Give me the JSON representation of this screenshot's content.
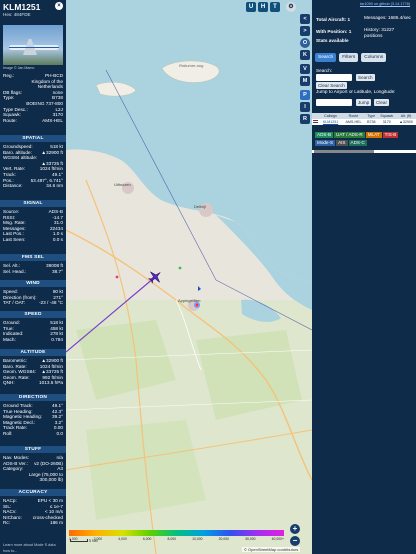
{
  "left": {
    "callsign": "KLM1251",
    "subtitle": "Hex: 484FDE",
    "photo_credit": "Image © Jan Mamo",
    "reg": [
      {
        "k": "Reg.:",
        "v": "PH-BCD"
      },
      {
        "k": "",
        "v": "Kingdom of the"
      },
      {
        "k": "",
        "v": "Netherlands"
      },
      {
        "k": "DB flags:",
        "v": "none"
      },
      {
        "k": "Type:",
        "v": "B738"
      },
      {
        "k": "",
        "v": "BOEING 737-800"
      },
      {
        "k": "Type Desc.:",
        "v": "L2J"
      },
      {
        "k": "Squawk:",
        "v": "3170"
      },
      {
        "k": "Route:",
        "v": "AMS-HEL"
      }
    ],
    "sections": {
      "spatial": "SPATIAL",
      "signal": "SIGNAL",
      "fms": "FMS SEL",
      "wind": "WIND",
      "speed": "SPEED",
      "altitude": "ALTITUDE",
      "direction": "DIRECTION",
      "stuff": "STUFF",
      "accuracy": "ACCURACY"
    },
    "spatial": [
      {
        "k": "Groundspeed:",
        "v": "518 kt"
      },
      {
        "k": "Baro. altitude:",
        "v": "▲32900 ft"
      },
      {
        "k": "WGS84 altitude:",
        "v": ""
      },
      {
        "k": "",
        "v": "▲33725 ft"
      },
      {
        "k": "Vert. Rate:",
        "v": "1024 ft/min"
      },
      {
        "k": "Track:",
        "v": "49.1°"
      },
      {
        "k": "Pos.:",
        "v": "53.487°, 6.741°"
      },
      {
        "k": "Distance:",
        "v": "34.6 nm"
      }
    ],
    "signal": [
      {
        "k": "Source:",
        "v": "ADS-B"
      },
      {
        "k": "RSSI:",
        "v": "-14.7"
      },
      {
        "k": "Msg. Rate:",
        "v": "31.0"
      },
      {
        "k": "Messages:",
        "v": "22434"
      },
      {
        "k": "Last Pos.:",
        "v": "1.0 s"
      },
      {
        "k": "Last Seen:",
        "v": "0.0 s"
      }
    ],
    "fms": [
      {
        "k": "Sel. Alt.:",
        "v": "39008 ft"
      },
      {
        "k": "Sel. Head.:",
        "v": "38.7°"
      }
    ],
    "wind": [
      {
        "k": "Speed:",
        "v": "80 kt"
      },
      {
        "k": "Direction (from):",
        "v": "271°"
      },
      {
        "k": "TAT / OAT:",
        "v": "-23 / -48 °C"
      }
    ],
    "speed": [
      {
        "k": "Ground:",
        "v": "518 kt"
      },
      {
        "k": "True:",
        "v": "458 kt"
      },
      {
        "k": "Indicated:",
        "v": "278 kt"
      },
      {
        "k": "Mach:",
        "v": "0.784"
      }
    ],
    "altitude": [
      {
        "k": "Barometric:",
        "v": "▲32900 ft"
      },
      {
        "k": "Baro. Rate:",
        "v": "1024 ft/min"
      },
      {
        "k": "Geom. WGS84:",
        "v": "▲33725 ft"
      },
      {
        "k": "Geom. Rate:",
        "v": "992 ft/min"
      },
      {
        "k": "QNH:",
        "v": "1013.6 hPa"
      }
    ],
    "direction": [
      {
        "k": "Ground Track:",
        "v": "49.1°"
      },
      {
        "k": "True Heading:",
        "v": "42.3°"
      },
      {
        "k": "Magnetic Heading:",
        "v": "39.2°"
      },
      {
        "k": "Magnetic Decl.:",
        "v": "3.2°"
      },
      {
        "k": "Track Rate:",
        "v": "0.00"
      },
      {
        "k": "Roll:",
        "v": "0.0"
      }
    ],
    "stuff": [
      {
        "k": "Nav. Modes:",
        "v": "n/a"
      },
      {
        "k": "ADS-B Ver.:",
        "v": "v2 (DO-260B)"
      },
      {
        "k": "Category:",
        "v": "A3"
      },
      {
        "k": "",
        "v": "Large (75,000 to"
      },
      {
        "k": "",
        "v": "300,000 lb)"
      }
    ],
    "accuracy": [
      {
        "k": "NACp:",
        "v": "EPU < 30 m"
      },
      {
        "k": "SIL:",
        "v": "≤ 1e-7"
      },
      {
        "k": "NACv:",
        "v": "< 10 m/s"
      },
      {
        "k": "NICbaro:",
        "v": "cross-checked"
      },
      {
        "k": "Rc:",
        "v": "186 m"
      }
    ],
    "footer": "Learn more about Mode S data how to..."
  },
  "map": {
    "labels": {
      "island": "Rottumer-oog",
      "town1": "Uithuizen",
      "town2": "Delfzijl",
      "town3": "Appingedam"
    },
    "top_buttons": [
      "U",
      "H",
      "T"
    ],
    "side_buttons": [
      "<",
      ">",
      "O",
      "K",
      "V",
      "M",
      "P",
      "I",
      "R"
    ],
    "zoom_in": "+",
    "zoom_out": "−",
    "scale_label": "5 NM",
    "attribution": "© OpenStreetMap contributors",
    "alt_labels": [
      "1,000",
      "2,000",
      "4,000",
      "6,000",
      "8,000",
      "10,000",
      "20,000",
      "30,000",
      "40,000+"
    ]
  },
  "right": {
    "link": "tar1090 on github (3.14.1778)",
    "total_aircraft": "Total Aircraft: 1",
    "with_position": "With Position: 1",
    "stats": "Stats available",
    "messages": "Messages: 1686.4/sec",
    "history": "History: 31227 positions",
    "tabs": [
      "Search",
      "Filters",
      "Columns"
    ],
    "search_label": "Search:",
    "search_btn": "Search",
    "clear_search": "Clear Search",
    "jump_label": "Jump to Airport or Latitude, Longitude:",
    "jump_btn": "Jump",
    "clear_btn": "Clear",
    "table_headers": [
      "",
      "Callsign",
      "Route",
      "Type",
      "Squawk",
      "Alt. (ft)"
    ],
    "table_rows": [
      [
        "",
        "KLM1251",
        "AMS-HEL",
        "B738",
        "3170",
        "▲32900"
      ]
    ],
    "filters": [
      {
        "label": "ADS-B",
        "color": "#1e8c5a"
      },
      {
        "label": "UAT / ADS-R",
        "color": "#2a7a3a"
      },
      {
        "label": "MLAT",
        "color": "#d07000"
      },
      {
        "label": "TIS-B",
        "color": "#c03030"
      },
      {
        "label": "Mode-S",
        "color": "#3060a0"
      },
      {
        "label": "AIS",
        "color": "#505050"
      },
      {
        "label": "ADS-C",
        "color": "#1e6e5a"
      }
    ]
  }
}
